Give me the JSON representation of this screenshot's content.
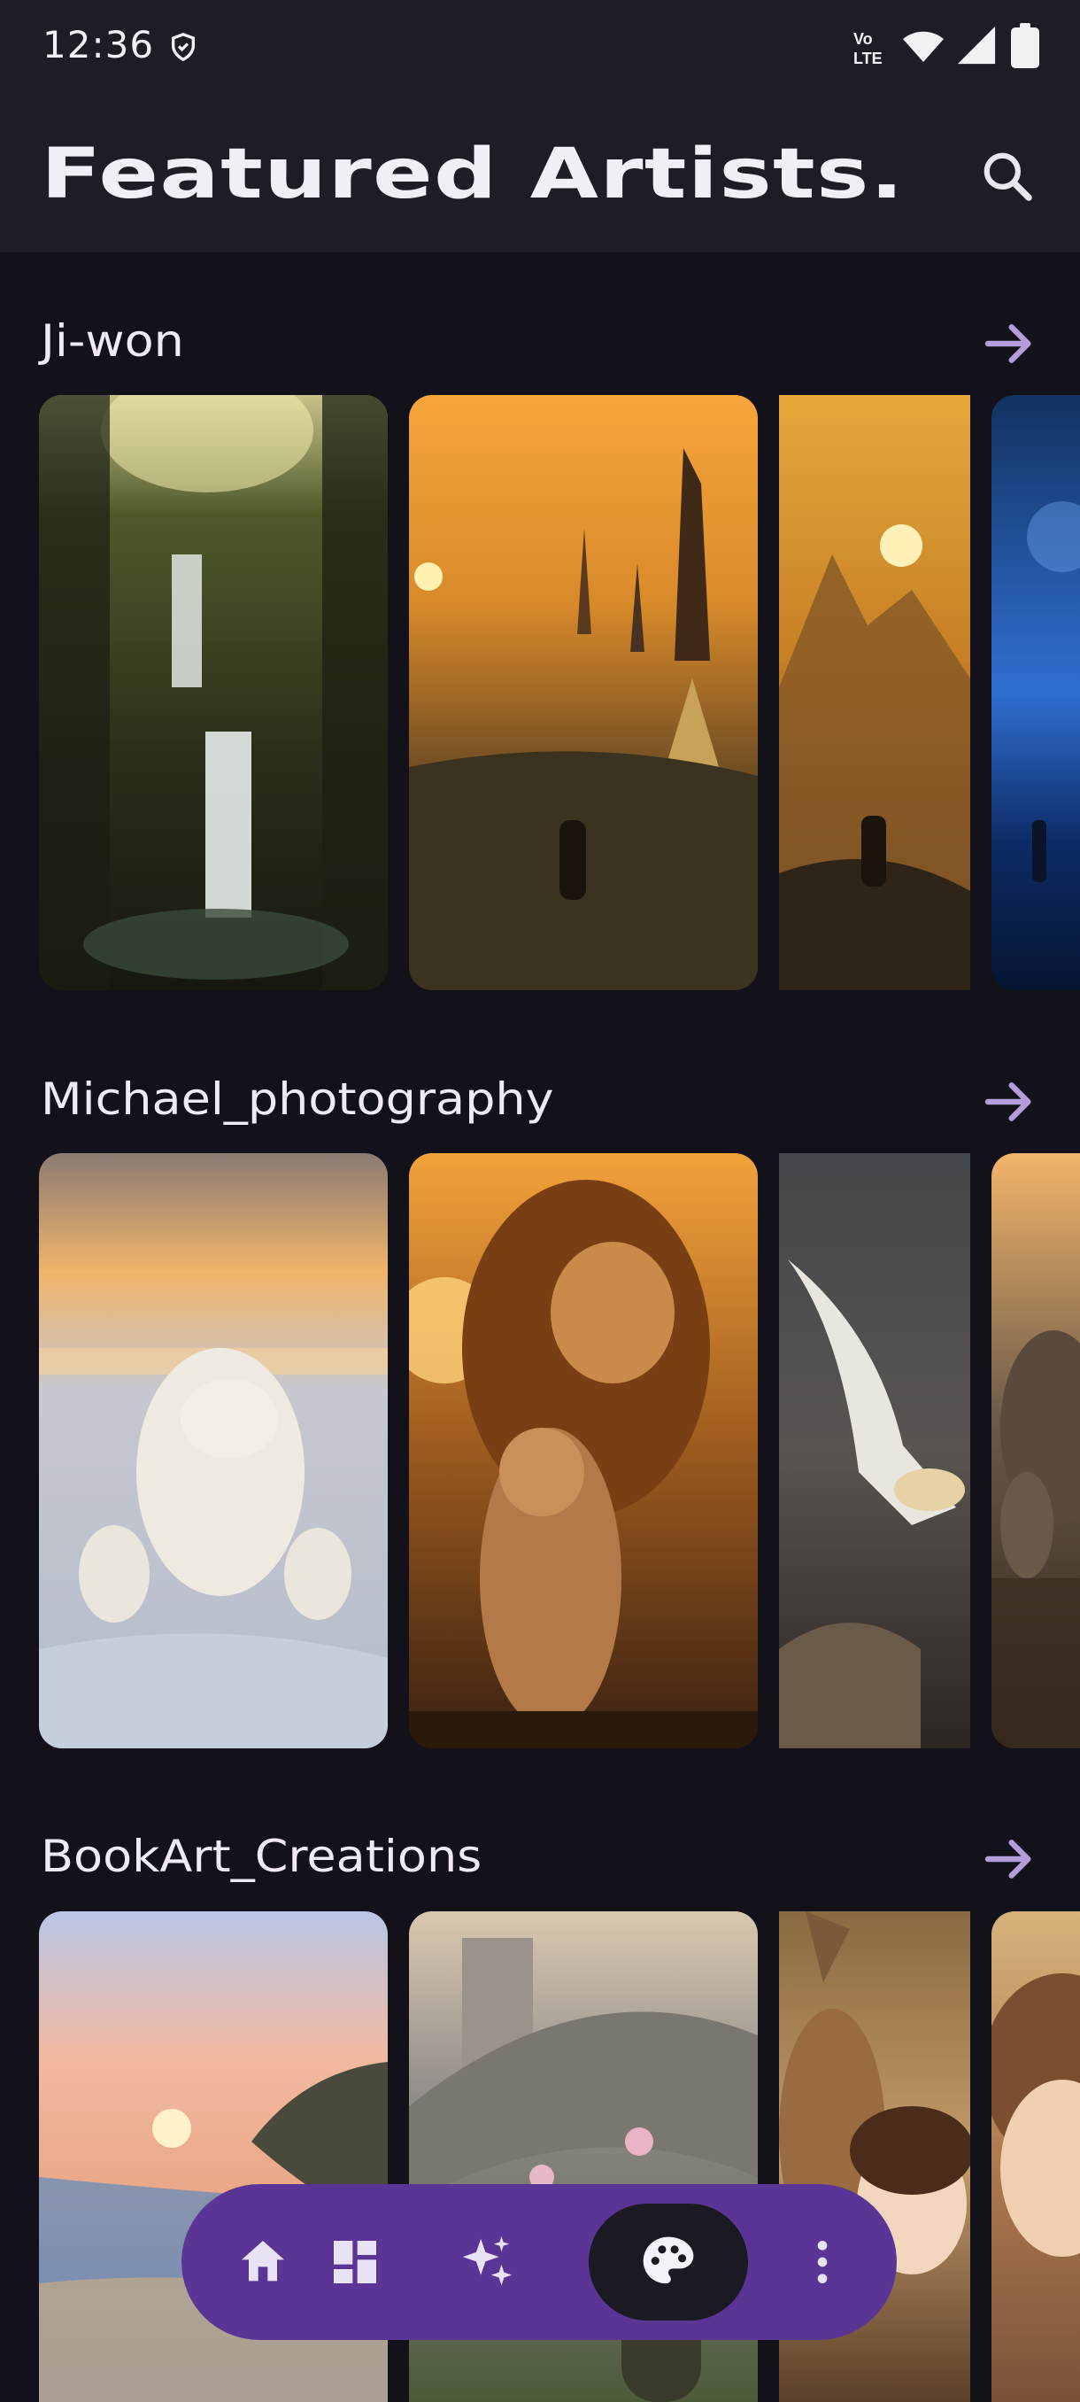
{
  "status_bar": {
    "time": "12:36",
    "icons": [
      "shield-icon",
      "volte-icon",
      "wifi-icon",
      "signal-icon",
      "battery-icon"
    ]
  },
  "app_bar": {
    "title": "Featured Artists.",
    "search_icon": "search-icon"
  },
  "sections": [
    {
      "artist": "Ji-won",
      "arrow_icon": "arrow-right-icon",
      "images": [
        "forest waterfall",
        "golden futuristic city",
        "mountain sunset silhouette",
        "blue cosmic night"
      ]
    },
    {
      "artist": "Michael_photography",
      "arrow_icon": "arrow-right-icon",
      "images": [
        "polar bear family",
        "lion and cub at sunset",
        "gannet in flight",
        "elephants at water"
      ]
    },
    {
      "artist": "BookArt_Creations",
      "arrow_icon": "arrow-right-icon",
      "images": [
        "tropical beach sunset",
        "storybook cottage",
        "girl with deer",
        "child portrait"
      ]
    }
  ],
  "bottom_nav": {
    "items": [
      "home-icon",
      "dashboard-icon",
      "sparkle-icon",
      "palette-icon",
      "more-vert-icon"
    ],
    "active": "palette-icon"
  },
  "colors": {
    "background": "#13111a",
    "bar": "#1e1d25",
    "accent": "#b39ddb",
    "nav": "#5a3596"
  }
}
